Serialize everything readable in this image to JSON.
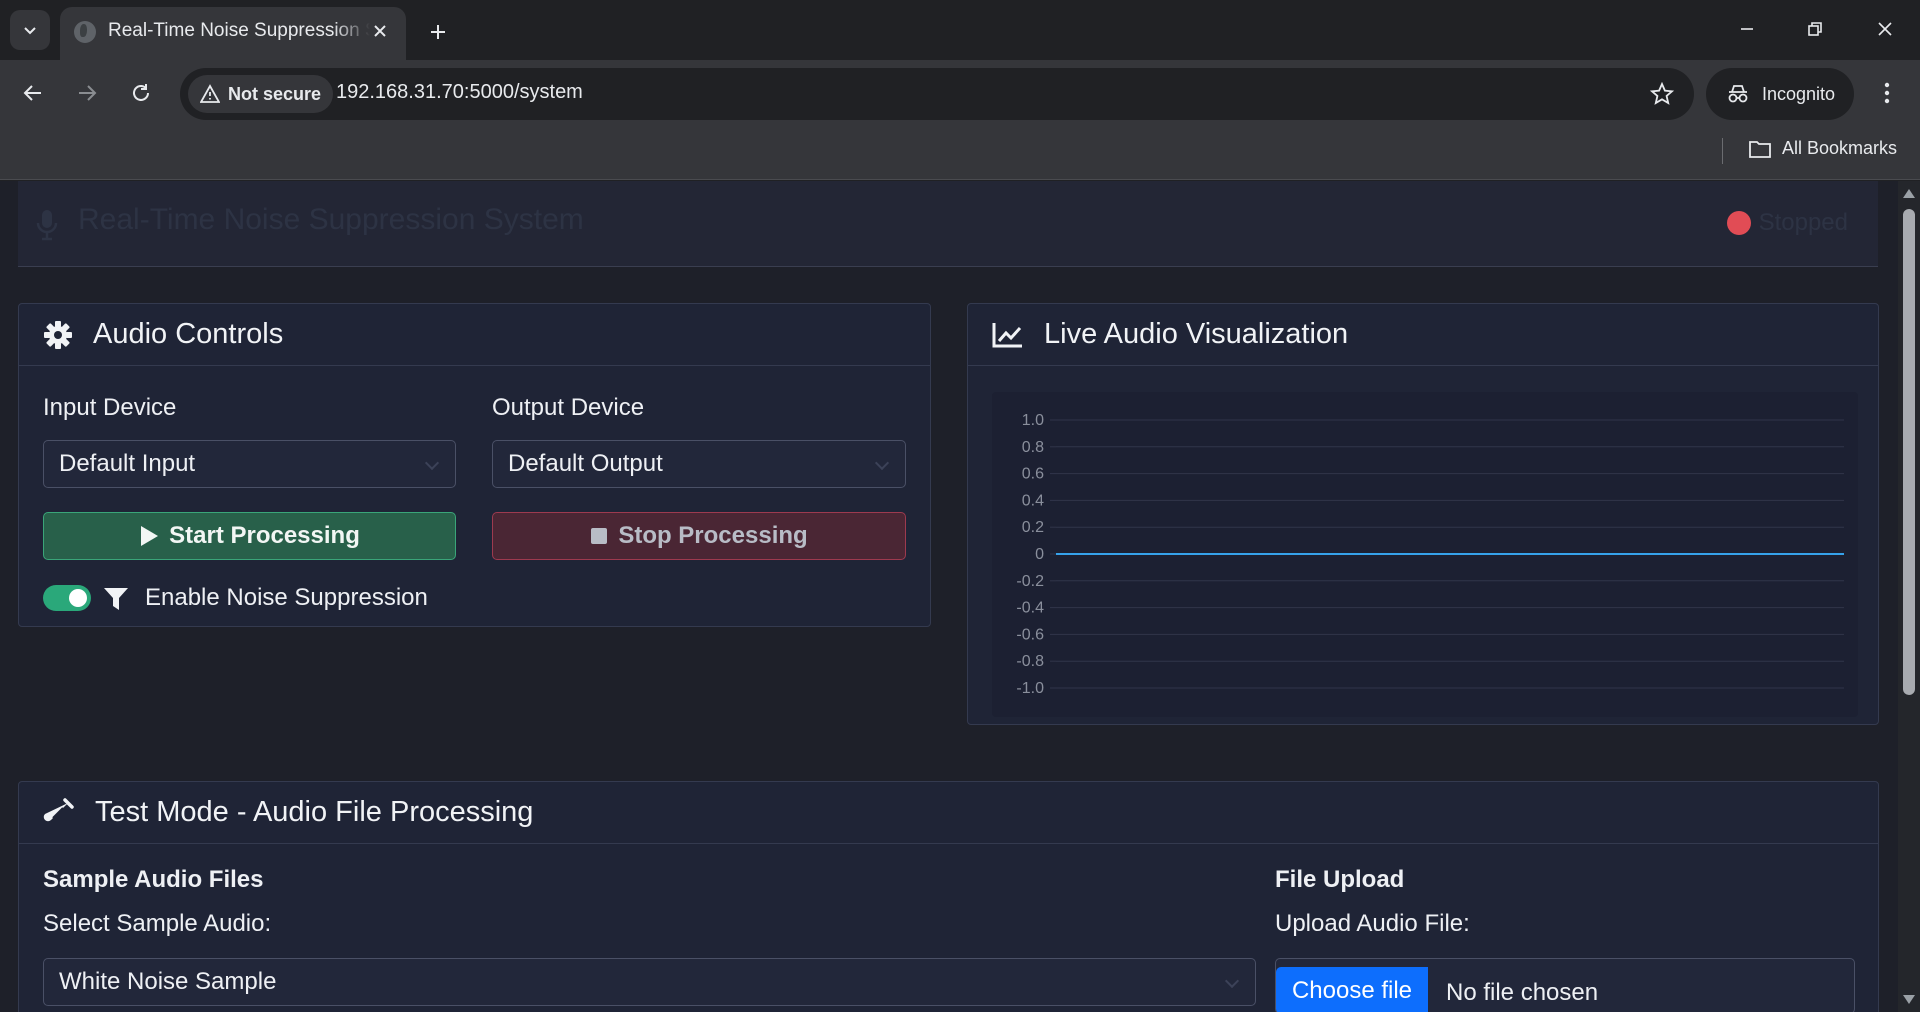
{
  "browser": {
    "tab_title": "Real-Time Noise Suppression System",
    "security_label": "Not secure",
    "url": "192.168.31.70:5000/system",
    "profile_label": "Incognito",
    "bookmarks_label": "All Bookmarks"
  },
  "header": {
    "title": "Real-Time Noise Suppression System",
    "status_label": "Stopped",
    "status_color": "#e14c55"
  },
  "audio_controls": {
    "title": "Audio Controls",
    "input_label": "Input Device",
    "input_value": "Default Input",
    "output_label": "Output Device",
    "output_value": "Default Output",
    "start_label": "Start Processing",
    "stop_label": "Stop Processing",
    "toggle_label": "Enable Noise Suppression",
    "toggle_on": true
  },
  "visualization": {
    "title": "Live Audio Visualization"
  },
  "chart_data": {
    "type": "line",
    "title": "",
    "xlabel": "",
    "ylabel": "",
    "ylim": [
      -1.0,
      1.0
    ],
    "y_ticks": [
      "1.0",
      "0.8",
      "0.6",
      "0.4",
      "0.2",
      "0",
      "-0.2",
      "-0.4",
      "-0.6",
      "-0.8",
      "-1.0"
    ],
    "grid": true,
    "series": [
      {
        "values": [
          0,
          0,
          0,
          0,
          0,
          0,
          0,
          0,
          0,
          0,
          0
        ],
        "color": "#36a2eb"
      }
    ]
  },
  "test_mode": {
    "title": "Test Mode - Audio File Processing",
    "sample_heading": "Sample Audio Files",
    "sample_select_label": "Select Sample Audio:",
    "sample_value": "White Noise Sample",
    "upload_heading": "File Upload",
    "upload_label": "Upload Audio File:",
    "choose_button": "Choose file",
    "no_file_text": "No file chosen"
  },
  "colors": {
    "accent_green": "#28604a",
    "accent_red": "#4a2634",
    "toggle_green": "#2aa87a",
    "file_button_blue": "#0d6efd"
  }
}
